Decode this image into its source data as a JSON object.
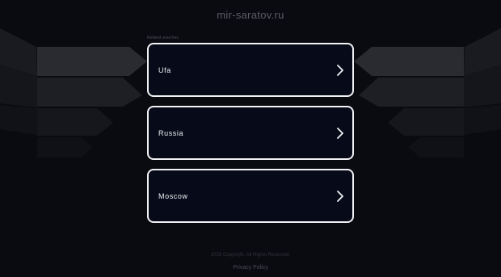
{
  "site": {
    "title": "mir-saratov.ru"
  },
  "related": {
    "heading": "Related searches",
    "items": [
      {
        "label": "Ufa"
      },
      {
        "label": "Russia"
      },
      {
        "label": "Moscow"
      }
    ]
  },
  "footer": {
    "copyright": "2025 Copyright. All Rights Reserved.",
    "privacy": "Privacy Policy"
  },
  "colors": {
    "background": "#0a0b10",
    "card_fill": "#070a18",
    "card_border": "#f2f2f5"
  },
  "icons": {
    "chevron": "chevron-right-icon"
  }
}
